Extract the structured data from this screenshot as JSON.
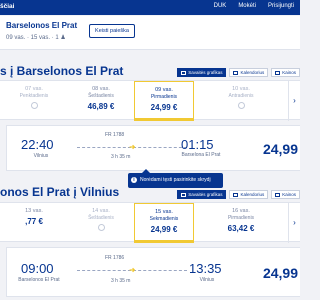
{
  "topbar": {
    "left_text": "ščiai",
    "right": [
      "DUK",
      "Mokėti",
      "Prisijungti"
    ]
  },
  "summary": {
    "route": "Barselonos El Prat",
    "meta": "09 vas. · 15 vas. · 1 ♟",
    "edit_label": "Keisti paieška"
  },
  "outbound": {
    "title": "s į Barselonos El Prat",
    "view": {
      "fare_label": "Savaitės grafikas",
      "calendar_label": "Kalendorius",
      "prices_label": "Kainos"
    },
    "dates": [
      {
        "date": "07 vas.",
        "weekday": "Penktadienis",
        "price": "",
        "available": false
      },
      {
        "date": "08 vas.",
        "weekday": "Šeštadienis",
        "price": "46,89 €",
        "available": true
      },
      {
        "date": "09 vas.",
        "weekday": "Pirmadienis",
        "price": "24,99 €",
        "available": true,
        "selected": true
      },
      {
        "date": "10 vas.",
        "weekday": "Antradienis",
        "price": "",
        "available": false
      }
    ],
    "flight": {
      "dep_time": "22:40",
      "dep_city": "Vilnius",
      "flight_no": "FR 1788",
      "duration": "3 h 35 m",
      "arr_time": "01:15",
      "arr_city": "Barselona El Prat",
      "price": "24,99"
    }
  },
  "inbound": {
    "title": "onos El Prat į Vilnius",
    "view": {
      "fare_label": "Savaitės grafikas",
      "calendar_label": "Kalendorius",
      "prices_label": "Kainos"
    },
    "dates": [
      {
        "date": "13 vas.",
        "weekday": "",
        "price": ",77 €",
        "available": true
      },
      {
        "date": "14 vas.",
        "weekday": "Šeštadienis",
        "price": "",
        "available": false
      },
      {
        "date": "15 vas.",
        "weekday": "Sekmadienis",
        "price": "24,99 €",
        "available": true,
        "selected": true
      },
      {
        "date": "16 vas.",
        "weekday": "Pirmadienis",
        "price": "63,42 €",
        "available": true
      }
    ],
    "flight": {
      "dep_time": "09:00",
      "dep_city": "Barselonos El Prat",
      "flight_no": "FR 1786",
      "duration": "3 h 35 m",
      "arr_time": "13:35",
      "arr_city": "Vilnius",
      "price": "24,99"
    }
  },
  "tooltip": {
    "text": "Norėdami tęsti pasirinkite skrydį"
  },
  "colors": {
    "brand": "#073590",
    "accent": "#f1c933",
    "background": "#f1f2f6"
  }
}
